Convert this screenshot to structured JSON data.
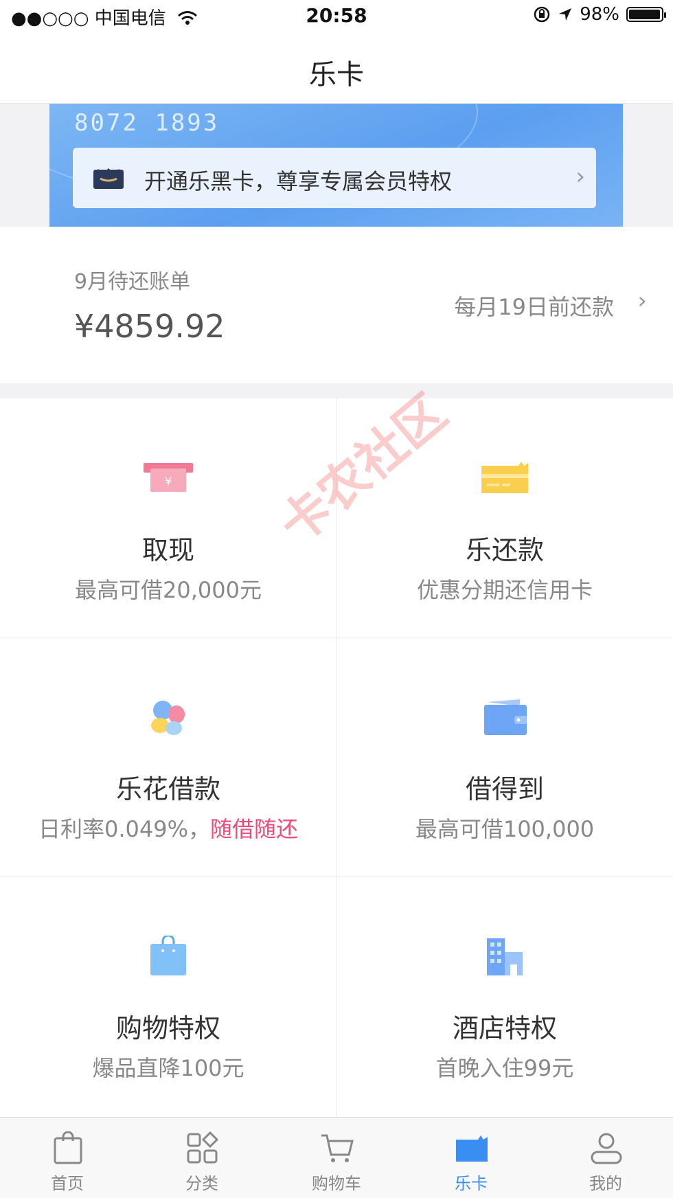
{
  "status_bar": {
    "carrier": "●●○○○ 中国电信",
    "wifi_icon": "wifi-icon",
    "time": "20:58",
    "battery": "98%",
    "battery_level": 0.98
  },
  "nav": {
    "title": "乐卡"
  },
  "card": {
    "number": "8072 1893",
    "banner_text": "开通乐黑卡，尊享专属会员特权"
  },
  "bill": {
    "label": "9月待还账单",
    "amount": "¥4859.92",
    "due": "每月19日前还款"
  },
  "services": [
    {
      "title": "取现",
      "sub": "最高可借20,000元"
    },
    {
      "title": "乐还款",
      "sub": "优惠分期还信用卡"
    },
    {
      "title": "乐花借款",
      "sub": "日利率0.049%，",
      "sub_highlight": "随借随还"
    },
    {
      "title": "借得到",
      "sub": "最高可借100,000"
    },
    {
      "title": "购物特权",
      "sub": "爆品直降100元"
    },
    {
      "title": "酒店特权",
      "sub": "首晚入住99元"
    }
  ],
  "tabs": [
    {
      "label": "首页"
    },
    {
      "label": "分类"
    },
    {
      "label": "购物车"
    },
    {
      "label": "乐卡"
    },
    {
      "label": "我的"
    }
  ],
  "watermark": "卡农社区",
  "colors": {
    "accent": "#3a8ef2",
    "highlight": "#ee4b7c",
    "card": "#5c9ff0"
  }
}
